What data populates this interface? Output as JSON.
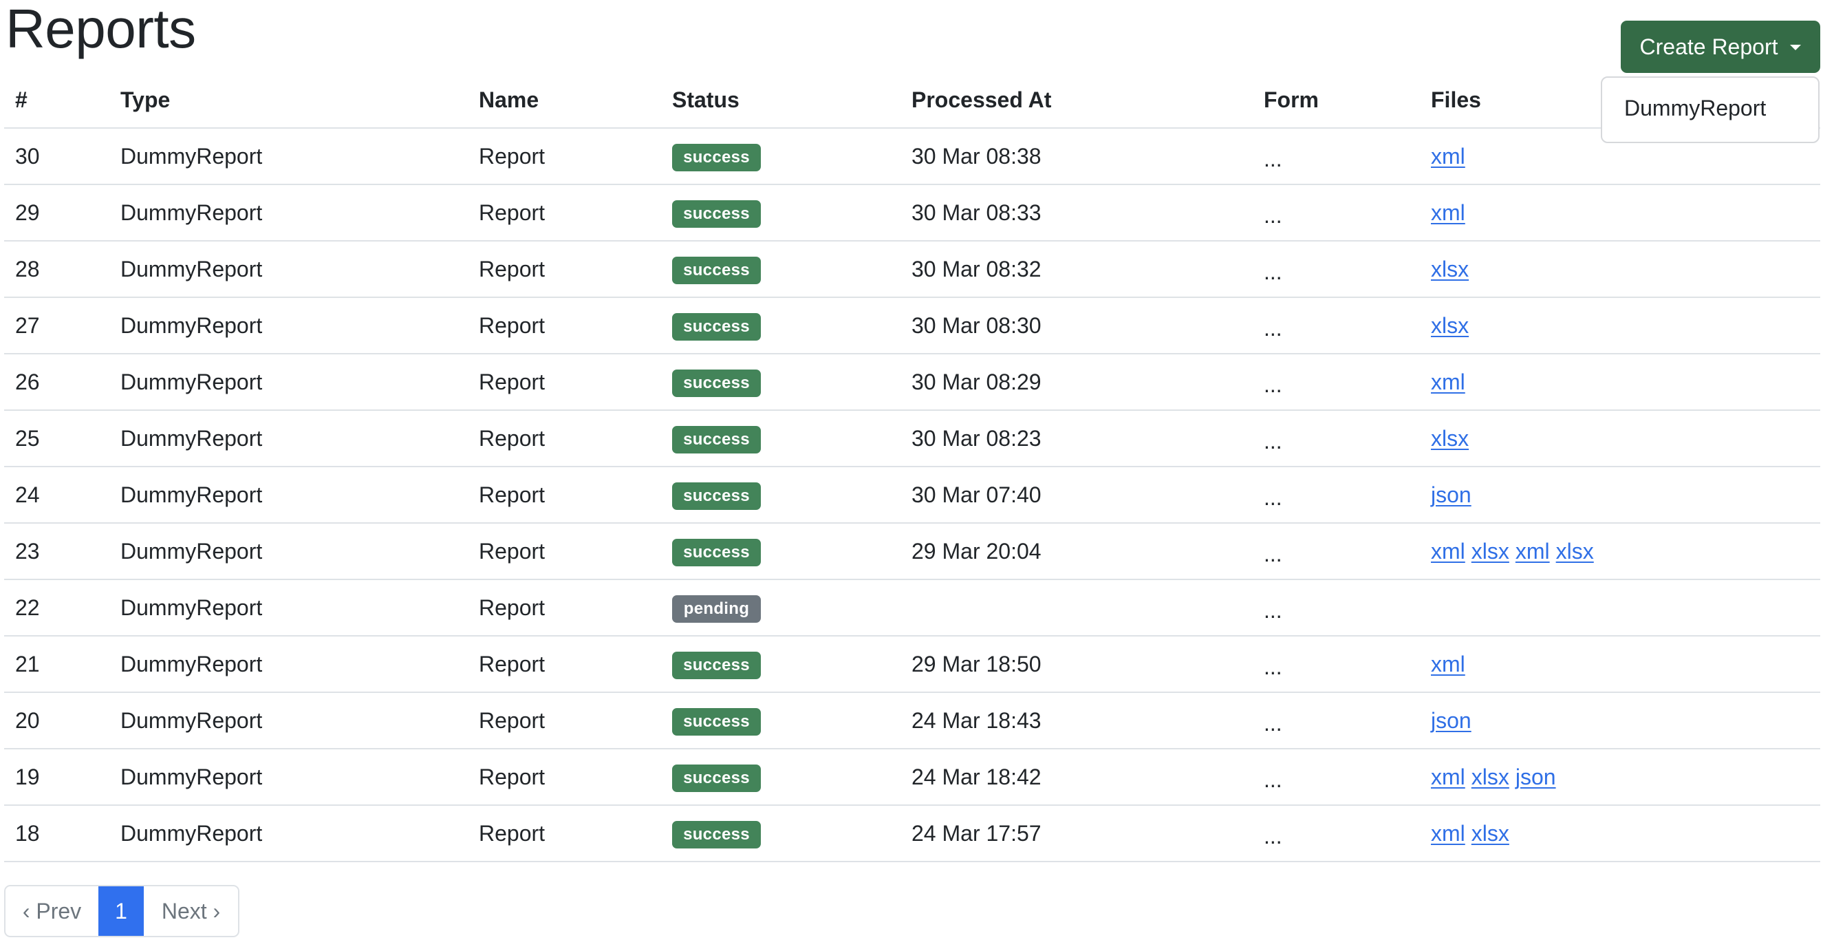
{
  "page": {
    "title": "Reports"
  },
  "create_report": {
    "label": "Create Report",
    "menu_items": [
      "DummyReport"
    ]
  },
  "table": {
    "headers": [
      "#",
      "Type",
      "Name",
      "Status",
      "Processed At",
      "Form",
      "Files"
    ],
    "rows": [
      {
        "id": "30",
        "type": "DummyReport",
        "name": "Report",
        "status": "success",
        "processed_at": "30 Mar 08:38",
        "form": "...",
        "files": [
          "xml"
        ]
      },
      {
        "id": "29",
        "type": "DummyReport",
        "name": "Report",
        "status": "success",
        "processed_at": "30 Mar 08:33",
        "form": "...",
        "files": [
          "xml"
        ]
      },
      {
        "id": "28",
        "type": "DummyReport",
        "name": "Report",
        "status": "success",
        "processed_at": "30 Mar 08:32",
        "form": "...",
        "files": [
          "xlsx"
        ]
      },
      {
        "id": "27",
        "type": "DummyReport",
        "name": "Report",
        "status": "success",
        "processed_at": "30 Mar 08:30",
        "form": "...",
        "files": [
          "xlsx"
        ]
      },
      {
        "id": "26",
        "type": "DummyReport",
        "name": "Report",
        "status": "success",
        "processed_at": "30 Mar 08:29",
        "form": "...",
        "files": [
          "xml"
        ]
      },
      {
        "id": "25",
        "type": "DummyReport",
        "name": "Report",
        "status": "success",
        "processed_at": "30 Mar 08:23",
        "form": "...",
        "files": [
          "xlsx"
        ]
      },
      {
        "id": "24",
        "type": "DummyReport",
        "name": "Report",
        "status": "success",
        "processed_at": "30 Mar 07:40",
        "form": "...",
        "files": [
          "json"
        ]
      },
      {
        "id": "23",
        "type": "DummyReport",
        "name": "Report",
        "status": "success",
        "processed_at": "29 Mar 20:04",
        "form": "...",
        "files": [
          "xml",
          "xlsx",
          "xml",
          "xlsx"
        ]
      },
      {
        "id": "22",
        "type": "DummyReport",
        "name": "Report",
        "status": "pending",
        "processed_at": "",
        "form": "...",
        "files": []
      },
      {
        "id": "21",
        "type": "DummyReport",
        "name": "Report",
        "status": "success",
        "processed_at": "29 Mar 18:50",
        "form": "...",
        "files": [
          "xml"
        ]
      },
      {
        "id": "20",
        "type": "DummyReport",
        "name": "Report",
        "status": "success",
        "processed_at": "24 Mar 18:43",
        "form": "...",
        "files": [
          "json"
        ]
      },
      {
        "id": "19",
        "type": "DummyReport",
        "name": "Report",
        "status": "success",
        "processed_at": "24 Mar 18:42",
        "form": "...",
        "files": [
          "xml",
          "xlsx",
          "json"
        ]
      },
      {
        "id": "18",
        "type": "DummyReport",
        "name": "Report",
        "status": "success",
        "processed_at": "24 Mar 17:57",
        "form": "...",
        "files": [
          "xml",
          "xlsx"
        ]
      }
    ]
  },
  "pagination": {
    "prev_label": "‹ Prev",
    "current_page": "1",
    "next_label": "Next ›"
  },
  "colors": {
    "primary_button": "#346b46",
    "status_success": "#438459",
    "status_pending": "#6c757d",
    "link": "#2f6fe6",
    "active_page": "#3070ee"
  }
}
